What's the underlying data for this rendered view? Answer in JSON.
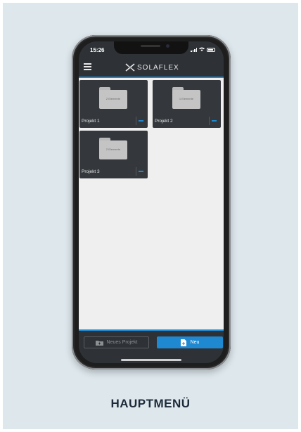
{
  "status": {
    "time": "15:26"
  },
  "app": {
    "logo": "SOLAFLEX"
  },
  "projects": [
    {
      "name": "Projekt 1",
      "count": "2 Elemente"
    },
    {
      "name": "Projekt 2",
      "count": "1 Elemente"
    },
    {
      "name": "Projekt 3",
      "count": "2 Elemente"
    }
  ],
  "buttons": {
    "new_project": "Neues Projekt",
    "new": "Neu"
  },
  "caption": "HAUPTMENÜ",
  "colors": {
    "accent": "#1e88d0",
    "card": "#34383c",
    "background": "#dde7ec"
  }
}
